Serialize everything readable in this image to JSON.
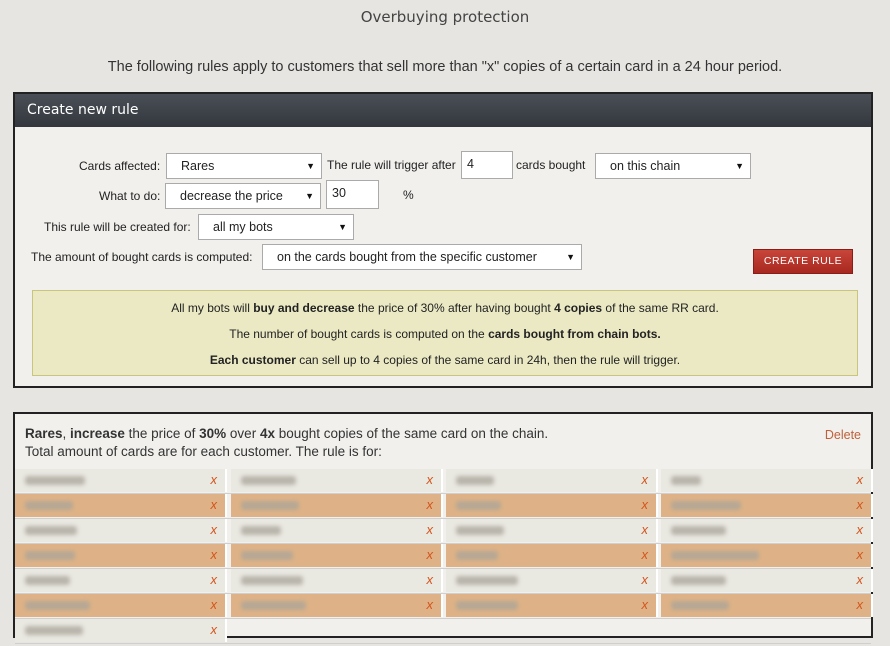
{
  "page": {
    "title": "Overbuying protection",
    "intro": "The following rules apply to customers that sell more than \"x\" copies of a certain card in a 24 hour period."
  },
  "create_rule": {
    "header": "Create new rule",
    "cards_affected_label": "Cards affected:",
    "cards_affected_value": "Rares",
    "trigger_label": "The rule will trigger after",
    "trigger_value": "4",
    "cards_bought_label": "cards bought",
    "chain_value": "on this chain",
    "what_to_do_label": "What to do:",
    "what_to_do_value": "decrease the price",
    "percent_value": "30",
    "percent_sign": "%",
    "created_for_label": "This rule will be created for:",
    "created_for_value": "all my bots",
    "computed_label": "The amount of bought cards is computed:",
    "computed_value": "on the cards bought from the specific customer",
    "create_button": "CREATE RULE",
    "summary": {
      "l1_a": "All my bots will ",
      "l1_b": "buy and decrease",
      "l1_c": " the price of 30% after having bought ",
      "l1_d": "4 copies",
      "l1_e": " of the same RR card.",
      "l2_a": "The number of bought cards is computed on the ",
      "l2_b": "cards bought from chain bots.",
      "l3_a": "Each customer",
      "l3_b": " can sell up to 4 copies of the same card in 24h, then the rule will trigger."
    }
  },
  "existing_rule": {
    "t_a": "Rares",
    "t_b": ", ",
    "t_c": "increase",
    "t_d": " the price of ",
    "t_e": "30%",
    "t_f": " over ",
    "t_g": "4x",
    "t_h": " bought copies of the same card on the chain.",
    "subtitle": "Total amount of cards are for each customer. The rule is for:",
    "delete": "Delete",
    "remove_glyph": "x"
  },
  "icons": {
    "dropdown_arrow": "caret-down-icon",
    "remove": "x-icon"
  },
  "colors": {
    "header_bg": "#3d4147",
    "create_button": "#b8332a",
    "summary_bg": "#ebe9c3",
    "row_tan": "#deb286",
    "row_light": "#e9e8e1",
    "remove_x": "#d4541c",
    "delete_link": "#c0603a"
  }
}
